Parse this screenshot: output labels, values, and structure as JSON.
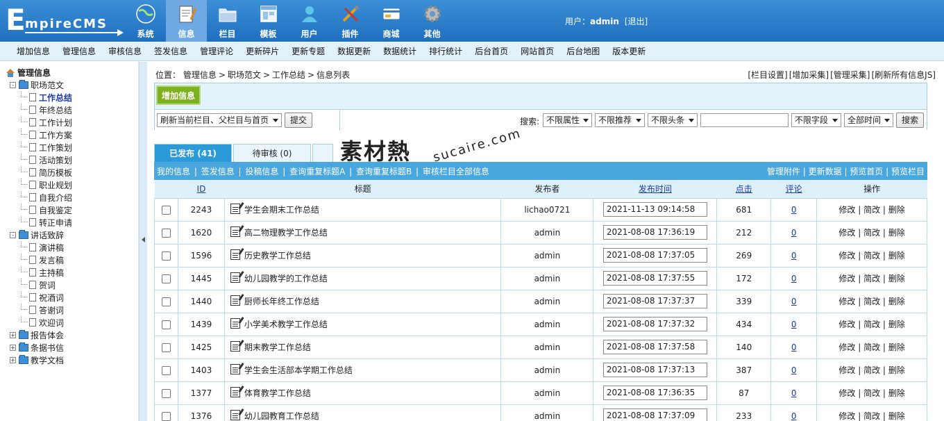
{
  "logo": {
    "first": "E",
    "rest": "mpireCMS"
  },
  "topnav": [
    {
      "label": "系统",
      "icon": "globe-icon"
    },
    {
      "label": "信息",
      "icon": "notepad-icon",
      "active": true
    },
    {
      "label": "栏目",
      "icon": "folder-icon"
    },
    {
      "label": "模板",
      "icon": "window-icon"
    },
    {
      "label": "用户",
      "icon": "user-icon"
    },
    {
      "label": "插件",
      "icon": "tools-icon"
    },
    {
      "label": "商城",
      "icon": "card-icon"
    },
    {
      "label": "其他",
      "icon": "gear-icon"
    }
  ],
  "user": {
    "prefix": "用户：",
    "name": "admin",
    "logout": "[退出]"
  },
  "subnav": [
    "增加信息",
    "管理信息",
    "审核信息",
    "签发信息",
    "管理评论",
    "更新碎片",
    "更新专题",
    "数据更新",
    "数据统计",
    "排行统计",
    "后台首页",
    "网站首页",
    "后台地图",
    "版本更新"
  ],
  "sidebar": {
    "root": "管理信息",
    "categories": [
      {
        "label": "职场范文",
        "toggle": "-",
        "children": [
          "工作总结",
          "年终总结",
          "工作计划",
          "工作方案",
          "工作策划",
          "活动策划",
          "简历模板",
          "职业规划",
          "自我介绍",
          "自我鉴定",
          "转正申请"
        ]
      },
      {
        "label": "讲话致辞",
        "toggle": "-",
        "children": [
          "演讲稿",
          "发言稿",
          "主持稿",
          "贺词",
          "祝酒词",
          "答谢词",
          "欢迎词"
        ]
      },
      {
        "label": "报告体会",
        "toggle": "+",
        "children": []
      },
      {
        "label": "条据书信",
        "toggle": "+",
        "children": []
      },
      {
        "label": "教学文档",
        "toggle": "+",
        "children": []
      }
    ]
  },
  "breadcrumb": {
    "label": "位置：",
    "parts": [
      "管理信息",
      "职场范文",
      "工作总结",
      "信息列表"
    ]
  },
  "top_links": [
    "[栏目设置]",
    "[增加采集]",
    "[管理采集]",
    "[刷新所有信息JS]"
  ],
  "add_button": "增加信息",
  "filter": {
    "refresh_select": "刷新当前栏目、父栏目与首页",
    "submit": "提交",
    "search_label": "搜索:",
    "attr": "不限属性",
    "recommend": "不限推荐",
    "headline": "不限头条",
    "search_value": "",
    "field": "不限字段",
    "time": "全部时间",
    "search_button": "搜索"
  },
  "watermark": {
    "zh": "素材熱",
    "en": "sucaire.com"
  },
  "tabs": [
    {
      "label": "已发布 (41)",
      "active": true
    },
    {
      "label": "待审核 (0)"
    },
    {
      "label": ""
    }
  ],
  "listbar": {
    "left": [
      "我的信息",
      "签发信息",
      "投稿信息",
      "查询重复标题A",
      "查询重复标题B",
      "审核栏目全部信息"
    ],
    "right": [
      "管理附件",
      "更新数据",
      "预览首页",
      "预览栏目"
    ]
  },
  "table": {
    "headers": {
      "id": "ID",
      "title": "标题",
      "publisher": "发布者",
      "time": "发布时间",
      "clicks": "点击",
      "comments": "评论",
      "ops": "操作"
    },
    "ops": [
      "修改",
      "简改",
      "删除"
    ],
    "rows": [
      {
        "id": "2243",
        "title": "学生会期末工作总结",
        "publisher": "lichao0721",
        "time": "2021-11-13 09:14:58",
        "clicks": "681",
        "comments": "0"
      },
      {
        "id": "1620",
        "title": "高二物理教学工作总结",
        "publisher": "admin",
        "time": "2021-08-08 17:36:19",
        "clicks": "212",
        "comments": "0"
      },
      {
        "id": "1596",
        "title": "历史教学工作总结",
        "publisher": "admin",
        "time": "2021-08-08 17:37:05",
        "clicks": "269",
        "comments": "0"
      },
      {
        "id": "1445",
        "title": "幼儿园教学的工作总结",
        "publisher": "admin",
        "time": "2021-08-08 17:37:55",
        "clicks": "172",
        "comments": "0"
      },
      {
        "id": "1440",
        "title": "厨师长年终工作总结",
        "publisher": "admin",
        "time": "2021-08-08 17:37:37",
        "clicks": "339",
        "comments": "0"
      },
      {
        "id": "1439",
        "title": "小学美术教学工作总结",
        "publisher": "admin",
        "time": "2021-08-08 17:37:32",
        "clicks": "434",
        "comments": "0"
      },
      {
        "id": "1425",
        "title": "期末教学工作总结",
        "publisher": "admin",
        "time": "2021-08-08 17:37:58",
        "clicks": "140",
        "comments": "0"
      },
      {
        "id": "1403",
        "title": "学生会生活部本学期工作总结",
        "publisher": "admin",
        "time": "2021-08-08 17:37:13",
        "clicks": "387",
        "comments": "0"
      },
      {
        "id": "1377",
        "title": "体育教学工作总结",
        "publisher": "admin",
        "time": "2021-08-08 17:36:35",
        "clicks": "87",
        "comments": "0"
      },
      {
        "id": "1376",
        "title": "幼儿园教育工作总结",
        "publisher": "admin",
        "time": "2021-08-08 17:37:09",
        "clicks": "233",
        "comments": "0"
      }
    ]
  }
}
